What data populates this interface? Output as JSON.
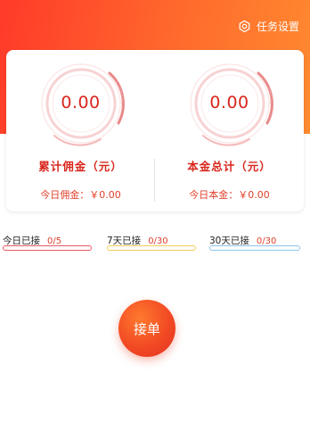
{
  "header": {
    "settings_label": "任务设置"
  },
  "commission": {
    "value": "0.00",
    "label": "累计佣金（元）",
    "today": "今日佣金：￥0.00"
  },
  "principal": {
    "value": "0.00",
    "label": "本金总计（元）",
    "today": "今日本金：￥0.00"
  },
  "stats": [
    {
      "label": "今日已接",
      "count": "0/5",
      "color": "#e85a60"
    },
    {
      "label": "7天已接",
      "count": "0/30",
      "color": "#f2cc55"
    },
    {
      "label": "30天已接",
      "count": "0/30",
      "color": "#8cc4ee"
    }
  ],
  "accept_button": "接单",
  "icons": {
    "settings": "gear-icon"
  },
  "colors": {
    "accent": "#f24a24",
    "header": "#ff4a2a",
    "value_text": "#d8261c"
  }
}
